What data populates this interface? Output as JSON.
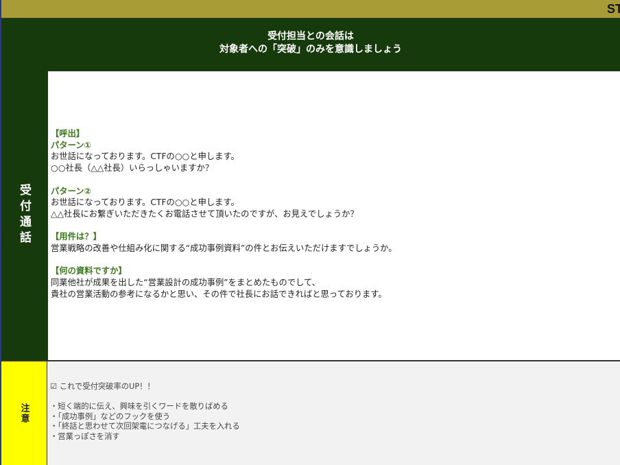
{
  "topbar": {
    "label": "ST"
  },
  "header": {
    "line1": "受付担当との会話は",
    "line2": "対象者への「突破」のみを意識しましょう"
  },
  "section": {
    "label": "受付通話"
  },
  "script": {
    "call_heading": "【呼出】",
    "pattern1_heading": "パターン①",
    "pattern1_lines": [
      "お世話になっております。CTFの○○と申します。",
      "○○社長（△△社長）いらっしゃいますか？"
    ],
    "pattern2_heading": "パターン②",
    "pattern2_lines": [
      "お世話になっております。CTFの○○と申します。",
      "△△社長にお繋ぎいただきたくお電話させて頂いたのですが、お見えでしょうか？"
    ],
    "purpose_heading": "【用件は？】",
    "purpose_lines": [
      "営業戦略の改善や仕組み化に関する“成功事例資料”の件とお伝えいただけますでしょうか。"
    ],
    "material_heading": "【何の資料ですか】",
    "material_lines": [
      "同業他社が成果を出した“営業設計の成功事例”をまとめたものでして、",
      "貴社の営業活動の参考になるかと思い、その件で社長にお話できればと思っております。"
    ]
  },
  "notes": {
    "label": "注意",
    "headline": "☑ これで受付突破率のUP！！",
    "items": [
      "・短く端的に伝え、興味を引くワードを散りばめる",
      "・「成功事例」などのフックを使う",
      "・「終話と思わせて次回架電につなげる」工夫を入れる",
      "・営業っぽさを消す"
    ]
  }
}
